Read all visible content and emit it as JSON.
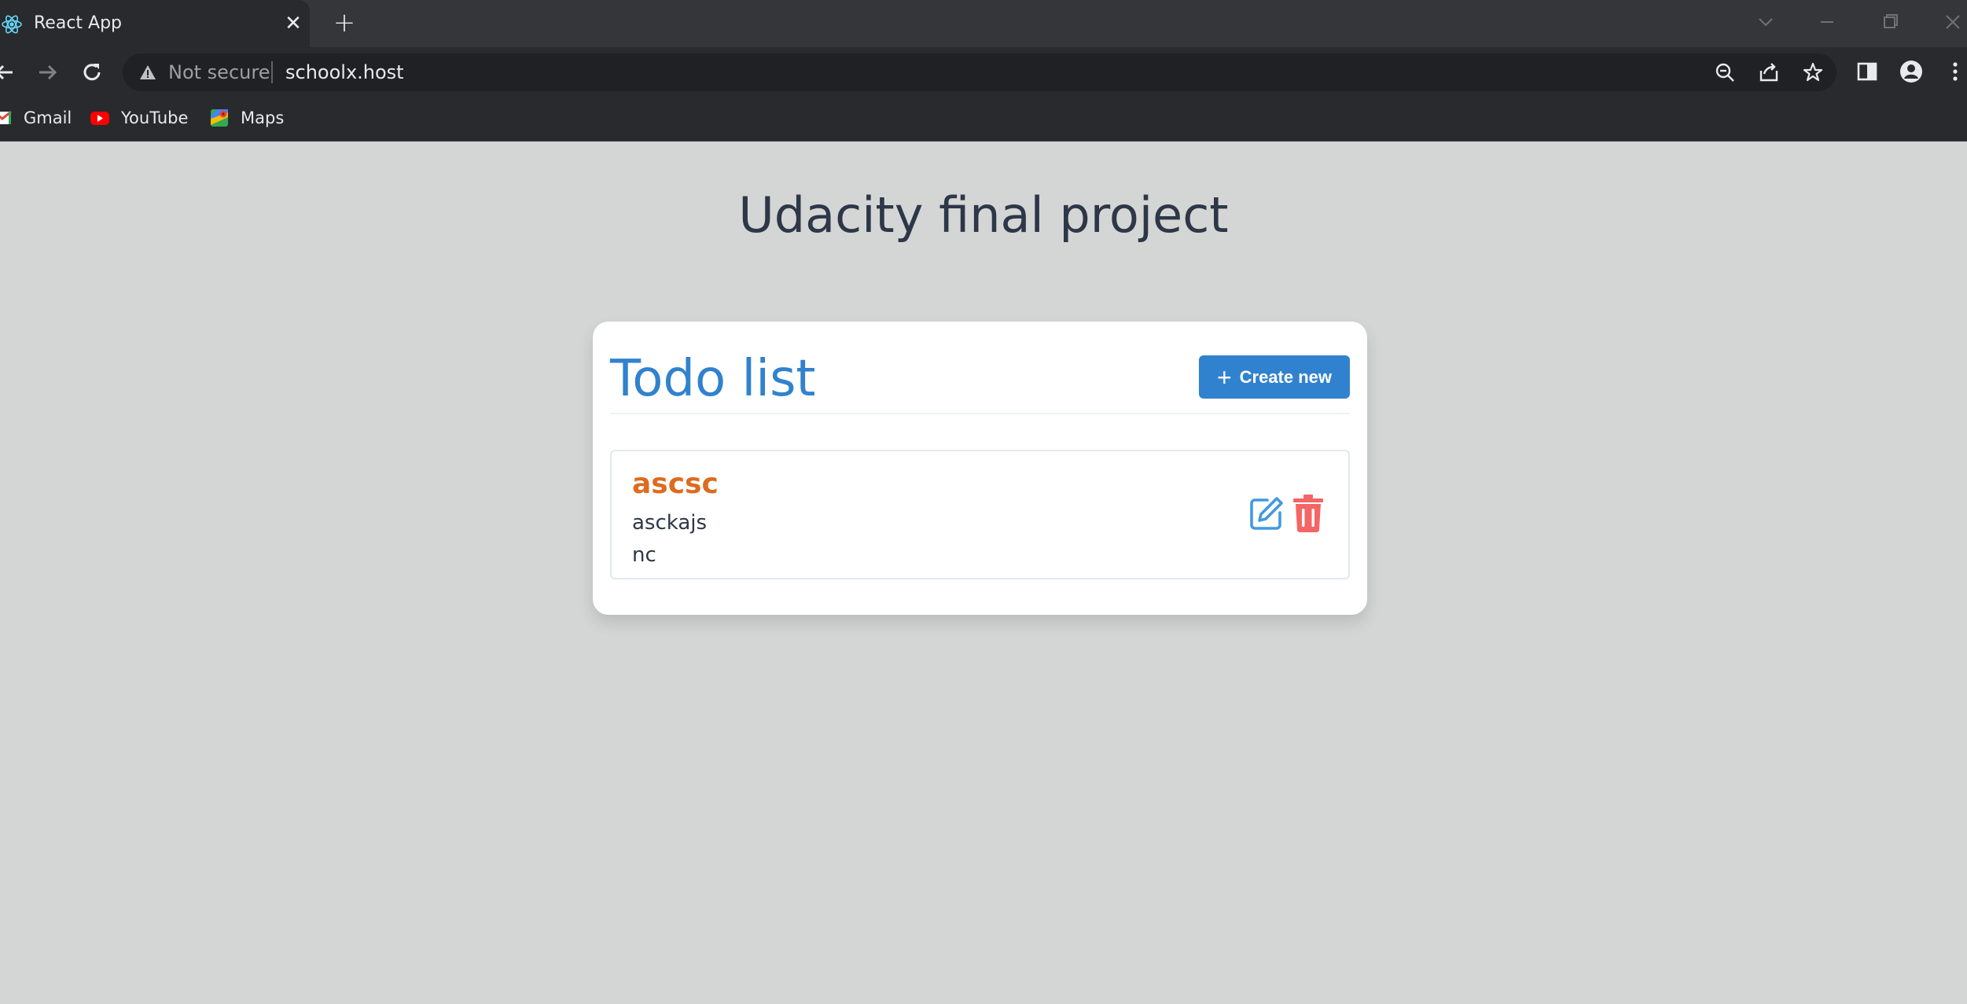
{
  "browser": {
    "tab_title": "React App",
    "tab_close": "✕",
    "new_tab": "+",
    "security_label": "Not secure",
    "url": "schoolx.host",
    "bookmarks": [
      {
        "label": "Gmail",
        "icon": "gmail-icon"
      },
      {
        "label": "YouTube",
        "icon": "youtube-icon"
      },
      {
        "label": "Maps",
        "icon": "maps-icon"
      }
    ]
  },
  "page": {
    "heading": "Udacity final project"
  },
  "todo": {
    "title": "Todo list",
    "create_button": "Create new",
    "create_button_icon": "+",
    "items": [
      {
        "title": "ascsc",
        "lines": [
          "asckajs",
          "nc"
        ]
      }
    ]
  },
  "colors": {
    "primary": "#3182ce",
    "item_title": "#dd6b20",
    "danger": "#f56565",
    "edit": "#4299e1",
    "page_bg": "#d4d6d5"
  }
}
